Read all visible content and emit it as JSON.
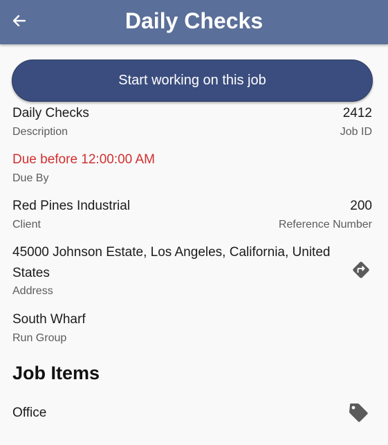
{
  "header": {
    "title": "Daily Checks",
    "back_icon": "arrow-left-icon"
  },
  "start_button": {
    "label": "Start working on this job"
  },
  "details": {
    "description": {
      "value": "Daily Checks",
      "label": "Description"
    },
    "job_id": {
      "value": "2412",
      "label": "Job ID"
    },
    "due_by": {
      "value": "Due before 12:00:00 AM",
      "label": "Due By",
      "color": "#d32f2f"
    },
    "client": {
      "value": "Red Pines Industrial",
      "label": "Client"
    },
    "reference_number": {
      "value": "200",
      "label": "Reference Number"
    },
    "address": {
      "line1": "45000 Johnson Estate, Los Angeles, California, United",
      "line2": "States",
      "label": "Address",
      "action_icon": "directions-icon"
    },
    "run_group": {
      "value": "South Wharf",
      "label": "Run Group"
    }
  },
  "job_items": {
    "title": "Job Items",
    "items": [
      {
        "name": "Office",
        "icon": "tag-icon"
      }
    ]
  },
  "colors": {
    "appbar": "#5a6f99",
    "button": "#3b4d7e",
    "background": "#f9f9f9"
  }
}
